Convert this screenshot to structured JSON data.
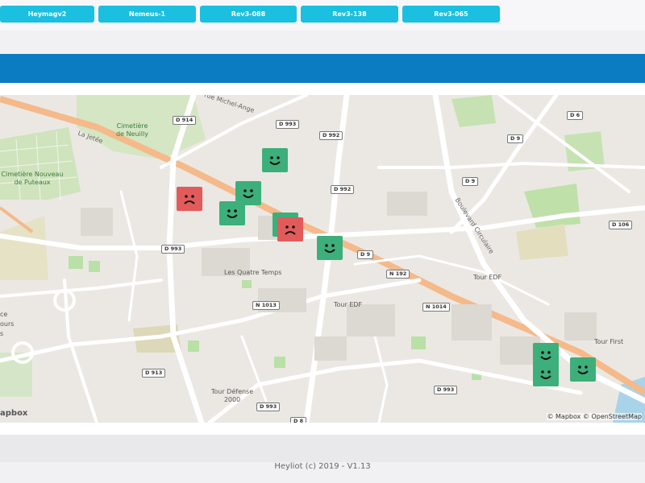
{
  "tabs": [
    {
      "label": "Heymagv2"
    },
    {
      "label": "Nemeus-1"
    },
    {
      "label": "Rev3-088"
    },
    {
      "label": "Rev3-138"
    },
    {
      "label": "Rev3-065"
    }
  ],
  "map": {
    "road_labels": [
      "D 914",
      "D 993",
      "D 992",
      "D 6",
      "D 9",
      "D 992",
      "D 9",
      "D 106",
      "D 993",
      "D 9",
      "N 192",
      "N 1013",
      "N 1014",
      "D 913",
      "D 993",
      "D 993",
      "D 8"
    ],
    "places": [
      "Les Quatre Temps",
      "Tour EDF",
      "Tour EDF",
      "Tour First",
      "Tour Défense\n2000"
    ],
    "cemeteries": [
      "Cimetière\nde Neuilly",
      "Cimetière Nouveau\nde Puteaux"
    ],
    "streets": [
      "rue Michel-Ange",
      "La Jetée",
      "Boulevard Circulaire"
    ],
    "edge_text": [
      "ce",
      "ours",
      "s"
    ],
    "markers": [
      {
        "mood": "happy"
      },
      {
        "mood": "sad"
      },
      {
        "mood": "happy"
      },
      {
        "mood": "happy"
      },
      {
        "mood": "happy"
      },
      {
        "mood": "sad"
      },
      {
        "mood": "happy"
      },
      {
        "mood": "happy"
      },
      {
        "mood": "happy"
      },
      {
        "mood": "happy"
      }
    ],
    "attribution": "© Mapbox © OpenStreetMap",
    "logo": "apbox"
  },
  "footer": "Heyliot (c) 2019 - V1.13",
  "colors": {
    "tab": "#1bbfe0",
    "band": "#0b7bc2",
    "happy": "#3daf7a",
    "sad": "#e25b5b"
  }
}
